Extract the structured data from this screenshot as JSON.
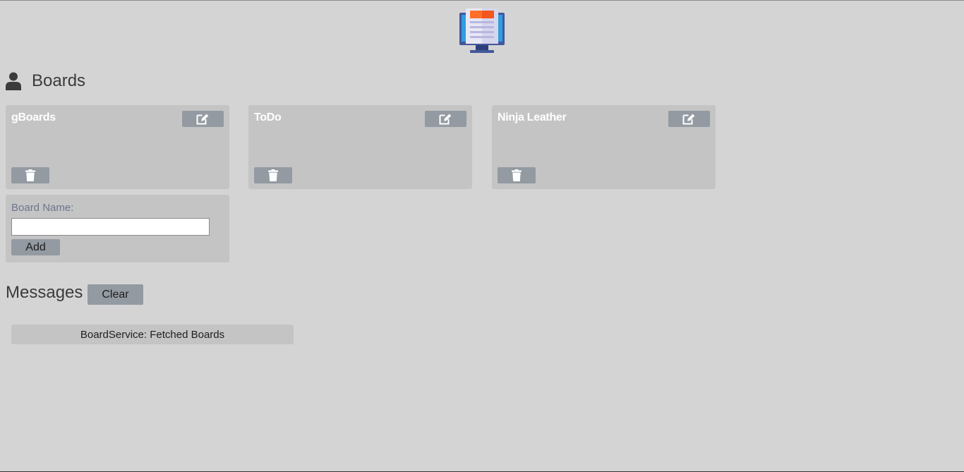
{
  "header": {
    "logo_icon": "monitor-document-icon"
  },
  "boards_section": {
    "title": "Boards",
    "icon": "user-icon"
  },
  "boards": [
    {
      "name": "gBoards",
      "edit_icon": "edit-icon",
      "delete_icon": "trash-icon"
    },
    {
      "name": "ToDo",
      "edit_icon": "edit-icon",
      "delete_icon": "trash-icon"
    },
    {
      "name": "Ninja Leather",
      "edit_icon": "edit-icon",
      "delete_icon": "trash-icon"
    }
  ],
  "add_board": {
    "label": "Board Name:",
    "input_value": "",
    "button_label": "Add"
  },
  "messages": {
    "title": "Messages",
    "clear_label": "Clear",
    "items": [
      "BoardService: Fetched Boards"
    ]
  },
  "colors": {
    "background": "#d4d4d4",
    "card": "#c4c4c4",
    "button": "#939aa1",
    "label": "#6a778a"
  }
}
